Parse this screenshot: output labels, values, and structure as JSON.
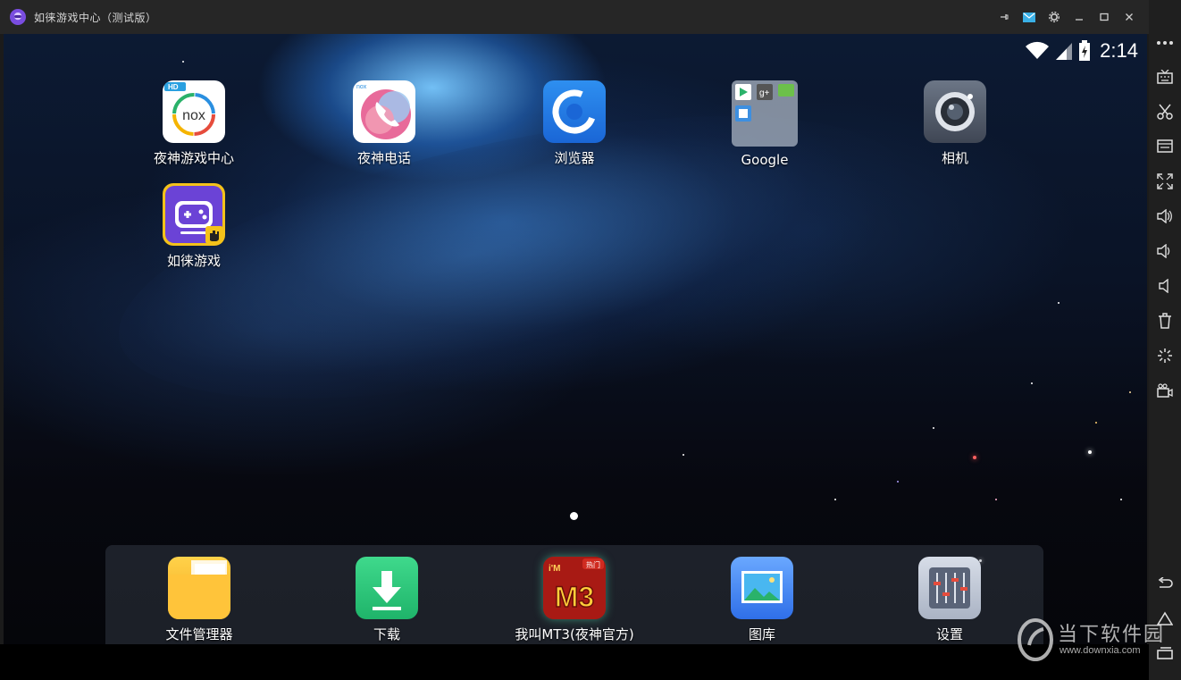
{
  "window": {
    "title": "如徕游戏中心（测试版）",
    "controls": [
      "pin-icon",
      "mail-icon",
      "gear-icon",
      "minimize-icon",
      "maximize-icon",
      "close-icon"
    ]
  },
  "status": {
    "time": "2:14"
  },
  "home_apps": [
    {
      "label": "夜神游戏中心",
      "icon": "nox-game-center-icon"
    },
    {
      "label": "夜神电话",
      "icon": "phone-icon"
    },
    {
      "label": "浏览器",
      "icon": "browser-icon"
    },
    {
      "label": "Google",
      "icon": "google-folder-icon"
    },
    {
      "label": "相机",
      "icon": "camera-icon"
    },
    {
      "label": "如徕游戏",
      "icon": "game-controller-icon"
    }
  ],
  "dock_apps": [
    {
      "label": "文件管理器",
      "icon": "folder-icon"
    },
    {
      "label": "下载",
      "icon": "download-icon"
    },
    {
      "label": "我叫MT3(夜神官方)",
      "icon": "mt3-game-icon",
      "badge": "热门",
      "art_text": "M3"
    },
    {
      "label": "图库",
      "icon": "gallery-icon"
    },
    {
      "label": "设置",
      "icon": "settings-icon"
    }
  ],
  "icon_text": {
    "nox": "nox",
    "hd": "HD",
    "nox_small": "nox",
    "im": "i'M"
  },
  "watermark": {
    "text": "当下软件园",
    "url": "www.downxia.com"
  },
  "colors": {
    "titlebar": "#262626",
    "toolbar": "#1f1f1f",
    "navbar": "#000000"
  }
}
